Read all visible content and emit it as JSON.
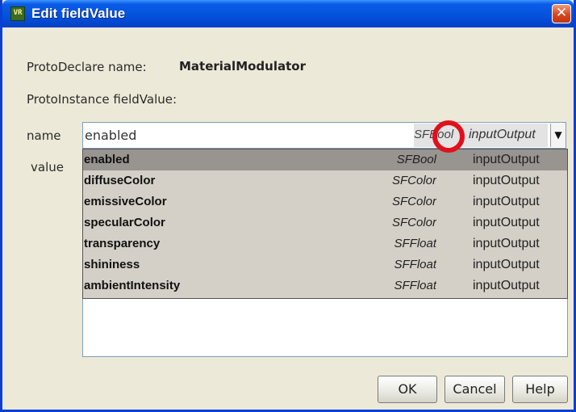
{
  "window": {
    "title": "Edit fieldValue",
    "title_icon": "x3d-app-icon",
    "close_glyph": "✕"
  },
  "proto_declare": {
    "label": "ProtoDeclare name:",
    "value": "MaterialModulator"
  },
  "proto_instance": {
    "label": "ProtoInstance fieldValue:"
  },
  "name_field": {
    "label": "name",
    "value": "enabled",
    "type": "SFBool",
    "access": "inputOutput",
    "arrow_glyph": "▼"
  },
  "value_field": {
    "label": "value"
  },
  "dropdown": {
    "options": [
      {
        "name": "enabled",
        "type": "SFBool",
        "access": "inputOutput",
        "selected": true
      },
      {
        "name": "diffuseColor",
        "type": "SFColor",
        "access": "inputOutput",
        "selected": false
      },
      {
        "name": "emissiveColor",
        "type": "SFColor",
        "access": "inputOutput",
        "selected": false
      },
      {
        "name": "specularColor",
        "type": "SFColor",
        "access": "inputOutput",
        "selected": false
      },
      {
        "name": "transparency",
        "type": "SFFloat",
        "access": "inputOutput",
        "selected": false
      },
      {
        "name": "shininess",
        "type": "SFFloat",
        "access": "inputOutput",
        "selected": false
      },
      {
        "name": "ambientIntensity",
        "type": "SFFloat",
        "access": "inputOutput",
        "selected": false
      }
    ]
  },
  "buttons": {
    "ok": "OK",
    "cancel": "Cancel",
    "help": "Help"
  },
  "colors": {
    "titlebar": "#0453dc",
    "dialog_bg": "#ece9d8",
    "selected_row": "#989490",
    "annotation_circle": "#e0101c"
  }
}
